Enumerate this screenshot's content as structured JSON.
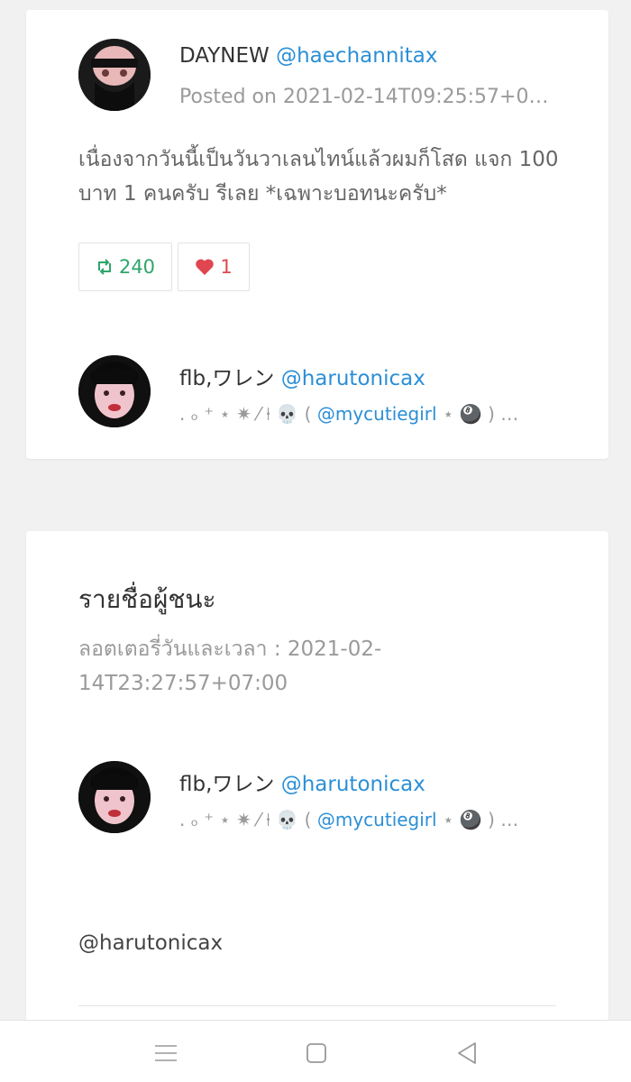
{
  "tweet": {
    "author_name": "DAYNEW",
    "author_handle": "@haechannitax",
    "posted": "Posted on 2021-02-14T09:25:57+0…",
    "text": "เนื่องจากวันนี้เป็นวันวาเลนไทน์แล้วผมก็โสด แจก 100 บาท 1 คนครับ รีเลย *เฉพาะบอทนะครับ*",
    "retweet_count": "240",
    "like_count": "1",
    "retweet_icon": "retweet-icon",
    "like_icon": "heart-icon"
  },
  "participant": {
    "name": "flb,ワレン",
    "handle": "@harutonicax",
    "bio_prefix": ". ₒ ⁺ ⋆ ✷ ⁄ ⍿ 💀 (",
    "bio_mention": "@mycutiegirl",
    "bio_suffix": "⋆ 🎱 ) …"
  },
  "winners": {
    "title": "รายชื่อผู้ชนะ",
    "lottery_time": "ลอตเตอรี่วันและเวลา : 2021-02-14T23:27:57+07:00",
    "winner": {
      "name": "flb,ワレン",
      "handle": "@harutonicax",
      "bio_prefix": ". ₒ ⁺ ⋆ ✷ ⁄ ⍿ 💀 (",
      "bio_mention": "@mycutiegirl",
      "bio_suffix": "⋆ 🎱 ) …"
    },
    "winner_handle_text": "@harutonicax"
  },
  "navbar": {
    "menu_icon": "menu-icon",
    "home_icon": "home-square-icon",
    "back_icon": "back-triangle-icon"
  },
  "colors": {
    "link": "#2b8fd6",
    "retweet": "#2fa56a",
    "like": "#e0464f",
    "muted": "#9a9a9a",
    "background": "#f1f1f1"
  }
}
